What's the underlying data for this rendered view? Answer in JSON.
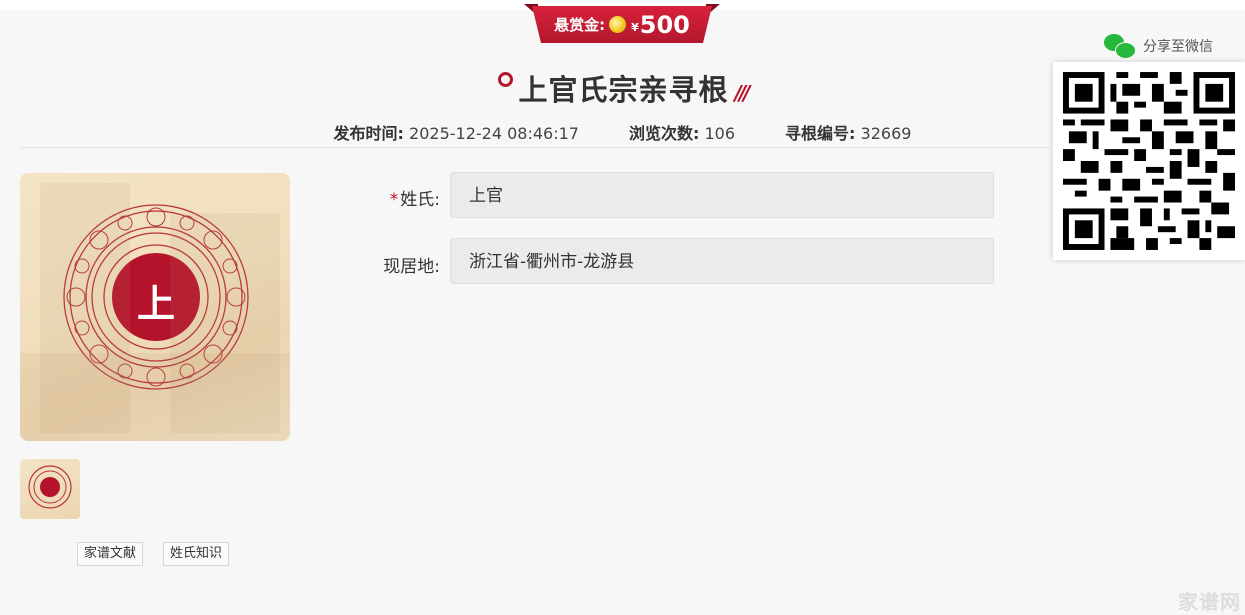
{
  "reward": {
    "label": "悬赏金:",
    "currency": "¥",
    "amount": "500"
  },
  "title": "上官氏宗亲寻根",
  "meta": {
    "publish_label": "发布时间:",
    "publish_value": "2025-12-24 08:46:17",
    "views_label": "浏览次数:",
    "views_value": "106",
    "id_label": "寻根编号:",
    "id_value": "32669"
  },
  "share": {
    "label": "分享至微信",
    "icon": "wechat-icon"
  },
  "photo": {
    "surname_char": "上"
  },
  "form": {
    "surname_required_mark": "*",
    "surname_label": "姓氏:",
    "surname_value": "上官",
    "residence_label": "现居地:",
    "residence_value": "浙江省-衢州市-龙游县"
  },
  "tags": [
    "家谱文献",
    "姓氏知识"
  ],
  "watermark": "家谱网",
  "colors": {
    "brand_red": "#b3152c",
    "wechat_green": "#25b83a",
    "field_bg": "#ebebeb",
    "page_bg": "#f7f7f7"
  }
}
